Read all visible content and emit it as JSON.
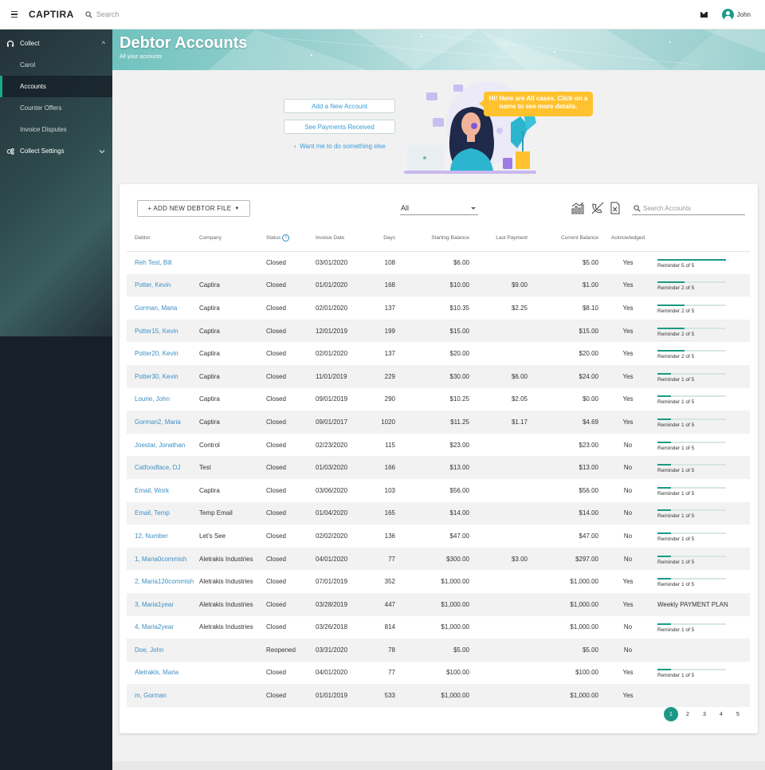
{
  "app": {
    "brand": "CAPTIRA",
    "search_placeholder": "Search",
    "user": "John"
  },
  "sidebar": {
    "items": [
      {
        "label": "Collect",
        "type": "section",
        "expanded": true
      },
      {
        "label": "Carol",
        "type": "sub"
      },
      {
        "label": "Accounts",
        "type": "sub",
        "active": true
      },
      {
        "label": "Counter Offers",
        "type": "sub"
      },
      {
        "label": "Invoice Disputes",
        "type": "sub"
      },
      {
        "label": "Collect Settings",
        "type": "section",
        "expanded": false
      }
    ]
  },
  "banner": {
    "title": "Debtor Accounts",
    "subtitle": "All your accounts"
  },
  "assistant": {
    "add_account": "Add a New Account",
    "see_payments": "See Payments Received",
    "something_else": "Want me to do something else",
    "bubble": "Hi! Here are All cases. Click on a name to see more details."
  },
  "toolbar": {
    "new_debtor_file": "+ ADD NEW DEBTOR FILE",
    "filter_value": "All",
    "search_placeholder": "Search Accounts"
  },
  "table": {
    "columns": [
      "Debtor",
      "Company",
      "Status",
      "Invoice Date",
      "Days",
      "Starting Balance",
      "Last Payment",
      "Current Balance",
      "Acknowledged",
      ""
    ],
    "rows": [
      {
        "debtor": "Reh Test, Bill",
        "company": "",
        "status": "Closed",
        "invoice_date": "03/01/2020",
        "days": "108",
        "starting": "$6.00",
        "last_payment": "",
        "current": "$5.00",
        "ack": "Yes",
        "reminder": "Reminder 5 of 5",
        "progress": 1.0
      },
      {
        "debtor": "Potter, Kevin",
        "company": "Captira",
        "status": "Closed",
        "invoice_date": "01/01/2020",
        "days": "168",
        "starting": "$10.00",
        "last_payment": "$9.00",
        "current": "$1.00",
        "ack": "Yes",
        "reminder": "Reminder 2 of 5",
        "progress": 0.4
      },
      {
        "debtor": "Gorman, Maria",
        "company": "Captira",
        "status": "Closed",
        "invoice_date": "02/01/2020",
        "days": "137",
        "starting": "$10.35",
        "last_payment": "$2.25",
        "current": "$8.10",
        "ack": "Yes",
        "reminder": "Reminder 2 of 5",
        "progress": 0.4
      },
      {
        "debtor": "Potter15, Kevin",
        "company": "Captira",
        "status": "Closed",
        "invoice_date": "12/01/2019",
        "days": "199",
        "starting": "$15.00",
        "last_payment": "",
        "current": "$15.00",
        "ack": "Yes",
        "reminder": "Reminder 2 of 5",
        "progress": 0.4
      },
      {
        "debtor": "Potter20, Kevin",
        "company": "Captira",
        "status": "Closed",
        "invoice_date": "02/01/2020",
        "days": "137",
        "starting": "$20.00",
        "last_payment": "",
        "current": "$20.00",
        "ack": "Yes",
        "reminder": "Reminder 2 of 5",
        "progress": 0.4
      },
      {
        "debtor": "Potter30, Kevin",
        "company": "Captira",
        "status": "Closed",
        "invoice_date": "11/01/2019",
        "days": "229",
        "starting": "$30.00",
        "last_payment": "$6.00",
        "current": "$24.00",
        "ack": "Yes",
        "reminder": "Reminder 1 of 5",
        "progress": 0.2
      },
      {
        "debtor": "Lourie, John",
        "company": "Captira",
        "status": "Closed",
        "invoice_date": "09/01/2019",
        "days": "290",
        "starting": "$10.25",
        "last_payment": "$2.05",
        "current": "$0.00",
        "ack": "Yes",
        "reminder": "Reminder 1 of 5",
        "progress": 0.2
      },
      {
        "debtor": "Gorman2, Maria",
        "company": "Captira",
        "status": "Closed",
        "invoice_date": "09/01/2017",
        "days": "1020",
        "starting": "$11.25",
        "last_payment": "$1.17",
        "current": "$4.69",
        "ack": "Yes",
        "reminder": "Reminder 1 of 5",
        "progress": 0.2
      },
      {
        "debtor": "Joestar, Jonathan",
        "company": "Control",
        "status": "Closed",
        "invoice_date": "02/23/2020",
        "days": "115",
        "starting": "$23.00",
        "last_payment": "",
        "current": "$23.00",
        "ack": "No",
        "reminder": "Reminder 1 of 5",
        "progress": 0.2
      },
      {
        "debtor": "Catfoodface, DJ",
        "company": "Test",
        "status": "Closed",
        "invoice_date": "01/03/2020",
        "days": "166",
        "starting": "$13.00",
        "last_payment": "",
        "current": "$13.00",
        "ack": "No",
        "reminder": "Reminder 1 of 5",
        "progress": 0.2
      },
      {
        "debtor": "Email, Work",
        "company": "Captira",
        "status": "Closed",
        "invoice_date": "03/06/2020",
        "days": "103",
        "starting": "$56.00",
        "last_payment": "",
        "current": "$56.00",
        "ack": "No",
        "reminder": "Reminder 1 of 5",
        "progress": 0.2
      },
      {
        "debtor": "Email, Temp",
        "company": "Temp Email",
        "status": "Closed",
        "invoice_date": "01/04/2020",
        "days": "165",
        "starting": "$14.00",
        "last_payment": "",
        "current": "$14.00",
        "ack": "No",
        "reminder": "Reminder 1 of 5",
        "progress": 0.2
      },
      {
        "debtor": "12, Number",
        "company": "Let's See",
        "status": "Closed",
        "invoice_date": "02/02/2020",
        "days": "136",
        "starting": "$47.00",
        "last_payment": "",
        "current": "$47.00",
        "ack": "No",
        "reminder": "Reminder 1 of 5",
        "progress": 0.2
      },
      {
        "debtor": "1, Maria0commish",
        "company": "Aletrakis Industries",
        "status": "Closed",
        "invoice_date": "04/01/2020",
        "days": "77",
        "starting": "$300.00",
        "last_payment": "$3.00",
        "current": "$297.00",
        "ack": "No",
        "reminder": "Reminder 1 of 5",
        "progress": 0.2
      },
      {
        "debtor": "2, Maria120commish",
        "company": "Aletrakis Industries",
        "status": "Closed",
        "invoice_date": "07/01/2019",
        "days": "352",
        "starting": "$1,000.00",
        "last_payment": "",
        "current": "$1,000.00",
        "ack": "Yes",
        "reminder": "Reminder 1 of 5",
        "progress": 0.2
      },
      {
        "debtor": "3, Maria1year",
        "company": "Aletrakis Industries",
        "status": "Closed",
        "invoice_date": "03/28/2019",
        "days": "447",
        "starting": "$1,000.00",
        "last_payment": "",
        "current": "$1,000.00",
        "ack": "Yes",
        "reminder": "Weekly PAYMENT PLAN",
        "progress": null
      },
      {
        "debtor": "4, Maria2year",
        "company": "Aletrakis Industries",
        "status": "Closed",
        "invoice_date": "03/26/2018",
        "days": "814",
        "starting": "$1,000.00",
        "last_payment": "",
        "current": "$1,000.00",
        "ack": "No",
        "reminder": "Reminder 1 of 5",
        "progress": 0.2
      },
      {
        "debtor": "Doe, John",
        "company": "",
        "status": "Reopened",
        "invoice_date": "03/31/2020",
        "days": "78",
        "starting": "$5.00",
        "last_payment": "",
        "current": "$5.00",
        "ack": "No",
        "reminder": "",
        "progress": null
      },
      {
        "debtor": "Aletrakis, Maria",
        "company": "",
        "status": "Closed",
        "invoice_date": "04/01/2020",
        "days": "77",
        "starting": "$100.00",
        "last_payment": "",
        "current": "$100.00",
        "ack": "Yes",
        "reminder": "Reminder 1 of 5",
        "progress": 0.2
      },
      {
        "debtor": "m, Gorman",
        "company": "",
        "status": "Closed",
        "invoice_date": "01/01/2019",
        "days": "533",
        "starting": "$1,000.00",
        "last_payment": "",
        "current": "$1,000.00",
        "ack": "Yes",
        "reminder": "",
        "progress": null
      }
    ]
  },
  "pagination": {
    "pages": [
      "1",
      "2",
      "3",
      "4",
      "5"
    ],
    "current": "1"
  },
  "colors": {
    "accent": "#1a9a86",
    "link": "#3d8fc4",
    "sidebar": "#17202a",
    "bubble": "#ffc22e"
  }
}
